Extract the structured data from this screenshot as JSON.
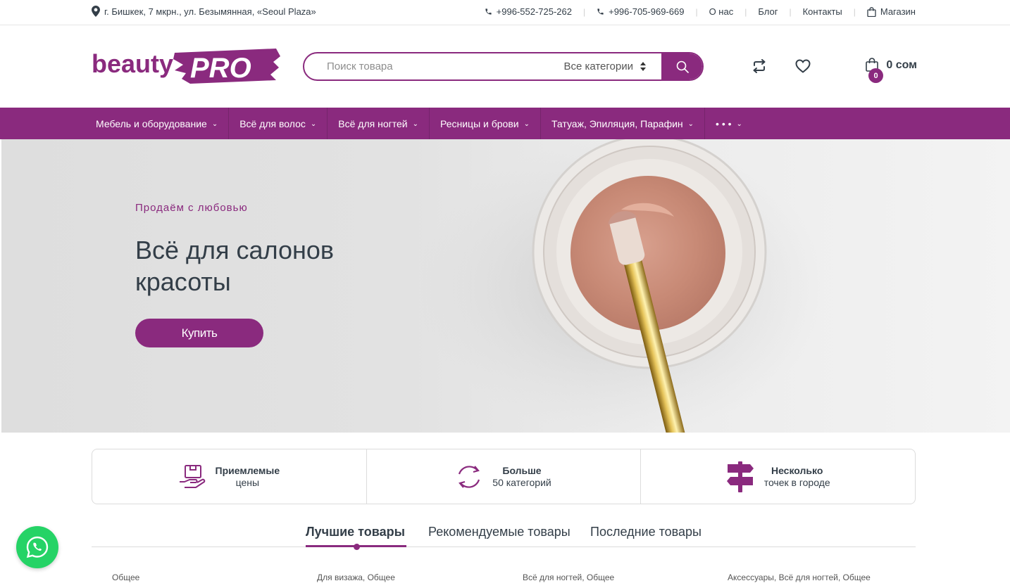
{
  "topbar": {
    "address": "г. Бишкек, 7 мкрн., ул. Безымянная, «Seoul Plaza»",
    "phone1": "+996-552-725-262",
    "phone2": "+996-705-969-669",
    "about": "О нас",
    "blog": "Блог",
    "contacts": "Контакты",
    "shop": "Магазин"
  },
  "logo": {
    "text_left": "beauty",
    "text_right": "PRO"
  },
  "search": {
    "placeholder": "Поиск товара",
    "category": "Все категории"
  },
  "cart": {
    "total": "0 сом",
    "count": "0"
  },
  "nav": {
    "items": [
      {
        "label": "Мебель и оборудование"
      },
      {
        "label": "Всё для волос"
      },
      {
        "label": "Всё для ногтей"
      },
      {
        "label": "Ресницы и брови"
      },
      {
        "label": "Татуаж, Эпиляция, Парафин"
      },
      {
        "label": "• • •"
      }
    ]
  },
  "hero": {
    "tagline": "Продаём с любовью",
    "title": "Всё для салонов красоты",
    "button": "Купить"
  },
  "features": [
    {
      "title": "Приемлемые",
      "subtitle": "цены",
      "icon": "hand-box-icon"
    },
    {
      "title": "Больше",
      "subtitle": "50 категорий",
      "icon": "refresh-circle-icon"
    },
    {
      "title": "Несколько",
      "subtitle": "точек в городе",
      "icon": "signpost-icon"
    }
  ],
  "tabs": {
    "best": "Лучшие товары",
    "recommended": "Рекомендуемые товары",
    "latest": "Последние товары"
  },
  "product_categories": [
    "Общее",
    "Для визажа, Общее",
    "Всё для ногтей, Общее",
    "Аксессуары, Всё для ногтей, Общее"
  ],
  "colors": {
    "brand": "#8a2a7e",
    "text": "#333e48",
    "whatsapp": "#25d366"
  }
}
